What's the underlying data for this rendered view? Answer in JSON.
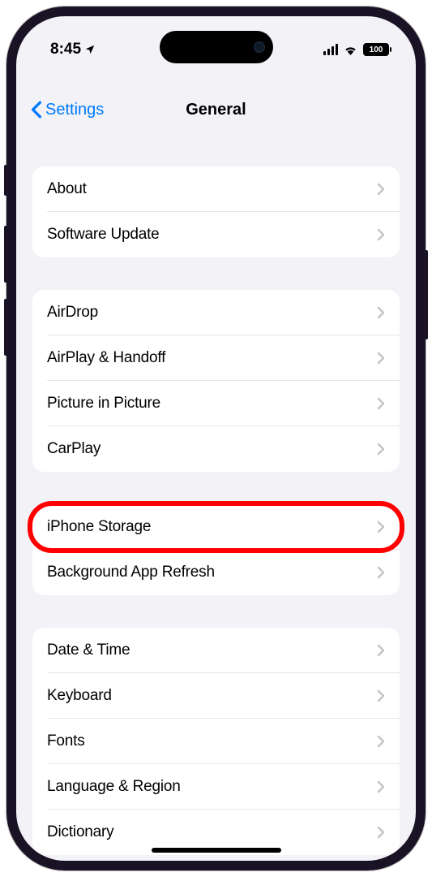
{
  "status": {
    "time": "8:45",
    "battery": "100"
  },
  "nav": {
    "back": "Settings",
    "title": "General"
  },
  "groups": [
    {
      "rows": [
        {
          "label": "About"
        },
        {
          "label": "Software Update"
        }
      ]
    },
    {
      "rows": [
        {
          "label": "AirDrop"
        },
        {
          "label": "AirPlay & Handoff"
        },
        {
          "label": "Picture in Picture"
        },
        {
          "label": "CarPlay"
        }
      ]
    },
    {
      "rows": [
        {
          "label": "iPhone Storage",
          "highlighted": true
        },
        {
          "label": "Background App Refresh"
        }
      ]
    },
    {
      "rows": [
        {
          "label": "Date & Time"
        },
        {
          "label": "Keyboard"
        },
        {
          "label": "Fonts"
        },
        {
          "label": "Language & Region"
        },
        {
          "label": "Dictionary"
        }
      ]
    }
  ]
}
